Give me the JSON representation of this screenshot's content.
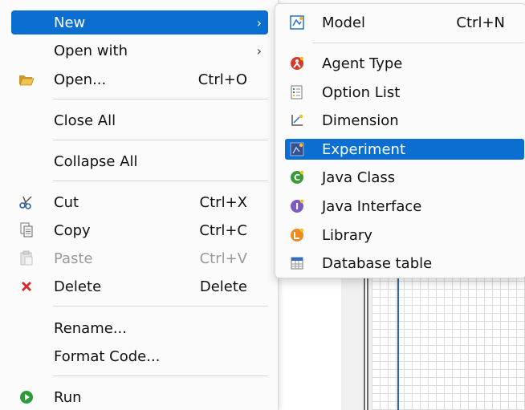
{
  "context_menu": {
    "items": [
      {
        "label": "New",
        "shortcut": "",
        "icon": "",
        "arrow": "›"
      },
      {
        "label": "Open with",
        "shortcut": "",
        "icon": "",
        "arrow": "›"
      },
      {
        "label": "Open...",
        "shortcut": "Ctrl+O",
        "icon": "folder-open-icon"
      },
      {
        "label": "Close All",
        "shortcut": "",
        "icon": ""
      },
      {
        "label": "Collapse All",
        "shortcut": "",
        "icon": ""
      },
      {
        "label": "Cut",
        "shortcut": "Ctrl+X",
        "icon": "scissors-icon"
      },
      {
        "label": "Copy",
        "shortcut": "Ctrl+C",
        "icon": "copy-icon"
      },
      {
        "label": "Paste",
        "shortcut": "Ctrl+V",
        "icon": "paste-icon",
        "disabled": true
      },
      {
        "label": "Delete",
        "shortcut": "Delete",
        "icon": "delete-icon"
      },
      {
        "label": "Rename...",
        "shortcut": "",
        "icon": ""
      },
      {
        "label": "Format Code...",
        "shortcut": "",
        "icon": ""
      },
      {
        "label": "Run",
        "shortcut": "",
        "icon": "run-icon"
      }
    ]
  },
  "new_submenu": {
    "items": [
      {
        "label": "Model",
        "shortcut": "Ctrl+N",
        "icon": "model-icon"
      },
      {
        "label": "Agent Type",
        "shortcut": "",
        "icon": "agent-type-icon"
      },
      {
        "label": "Option List",
        "shortcut": "",
        "icon": "option-list-icon"
      },
      {
        "label": "Dimension",
        "shortcut": "",
        "icon": "dimension-icon"
      },
      {
        "label": "Experiment",
        "shortcut": "",
        "icon": "experiment-icon"
      },
      {
        "label": "Java Class",
        "shortcut": "",
        "icon": "java-class-icon"
      },
      {
        "label": "Java Interface",
        "shortcut": "",
        "icon": "java-interface-icon"
      },
      {
        "label": "Library",
        "shortcut": "",
        "icon": "library-icon"
      },
      {
        "label": "Database table",
        "shortcut": "",
        "icon": "database-table-icon"
      }
    ]
  },
  "colors": {
    "highlight": "#0a6fd1",
    "menu_bg": "#fbfbfb",
    "disabled_text": "#9a9a9a",
    "delete_red": "#d9262b",
    "run_green": "#2e9b3a"
  }
}
